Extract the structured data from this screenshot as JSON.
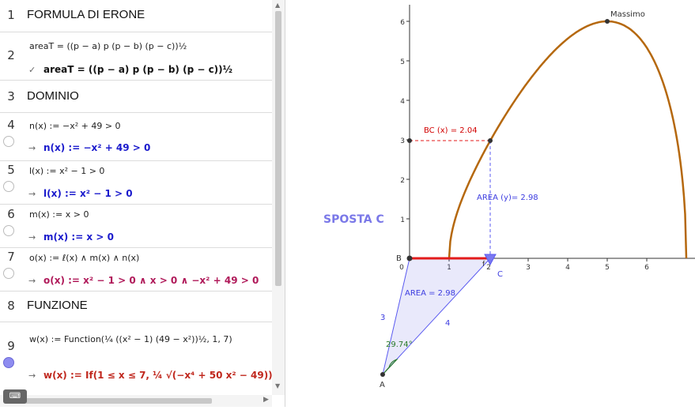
{
  "rows": [
    {
      "n": "1",
      "title": "FORMULA DI ERONE"
    },
    {
      "n": "2",
      "def": "areaT = ((p − a) p (p − b) (p − c))½",
      "res": "areaT = ((p − a) p (p − b) (p − c))½",
      "res_prefix": "✓"
    },
    {
      "n": "3",
      "title": "DOMINIO"
    },
    {
      "n": "4",
      "def": "n(x) := −x² + 49 > 0",
      "res": "n(x) := −x² + 49 > 0"
    },
    {
      "n": "5",
      "def": "l(x) := x² − 1 > 0",
      "res": "l(x) := x² − 1 > 0"
    },
    {
      "n": "6",
      "def": "m(x) := x > 0",
      "res": "m(x) := x > 0"
    },
    {
      "n": "7",
      "def": "o(x) := ℓ(x) ∧ m(x) ∧ n(x)",
      "res": "o(x) := x² − 1 > 0 ∧ x > 0 ∧ −x² + 49 > 0"
    },
    {
      "n": "8",
      "title": "FUNZIONE"
    },
    {
      "n": "9",
      "def": "w(x) := Function(¼ ((x² − 1) (49 − x²))½, 1, 7)",
      "res": "w(x) := If(1 ≤ x ≤ 7, ¼ √(−x⁴ + 50 x² − 49))"
    }
  ],
  "arrow": "→",
  "graph": {
    "sposta": "SPOSTA C",
    "massimo": "Massimo",
    "bc_label": "BC (x) = 2.04",
    "area_y_label": "AREA (y)= 2.98",
    "area_label": "AREA = 2.98",
    "angle_label": "29.74°",
    "side_a": "3",
    "side_b": "4",
    "pt_A": "A",
    "pt_B": "B",
    "pt_C": "C",
    "f_label": "f",
    "x_ticks": [
      "1",
      "2",
      "3",
      "4",
      "5",
      "6"
    ],
    "y_ticks": [
      "1",
      "2",
      "3",
      "4",
      "5",
      "6"
    ],
    "origin": "0",
    "colors": {
      "curve": "#b5680e",
      "segment": "#e31b1b",
      "triangle": "#5a5af0",
      "label_red": "#d20000"
    }
  }
}
